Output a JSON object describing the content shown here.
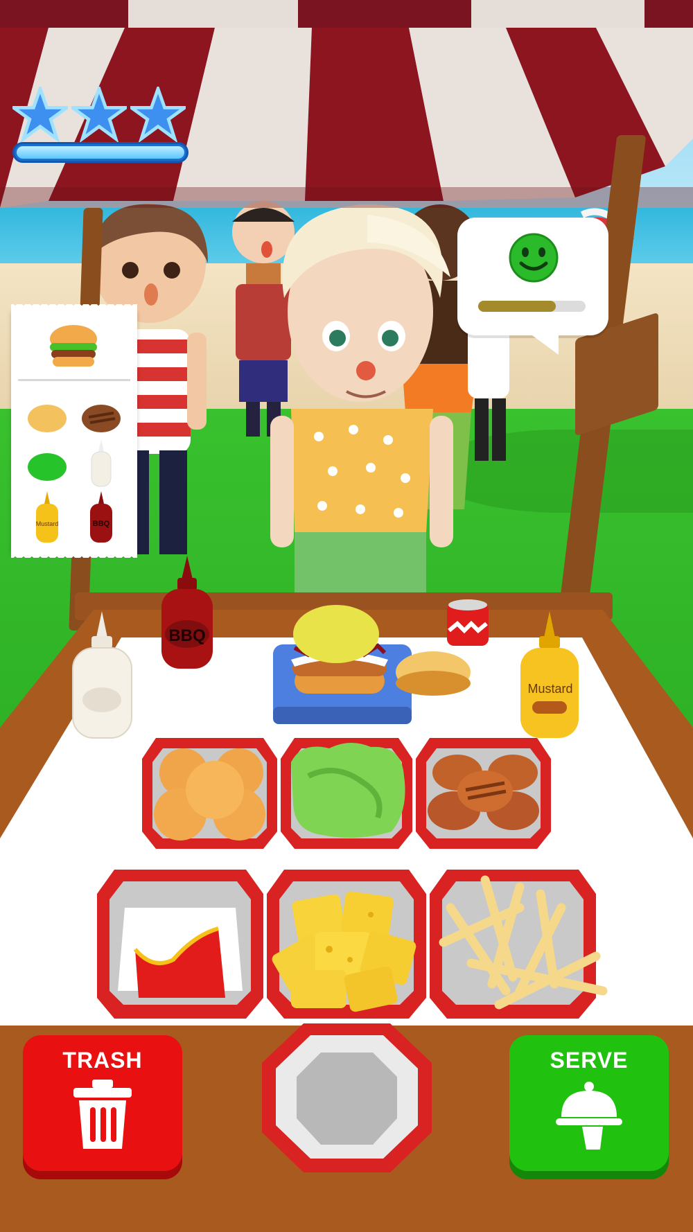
{
  "game": {
    "stars_earned": 3,
    "stars_total": 3,
    "level_progress": 1.0
  },
  "customer": {
    "mood": "happy",
    "patience": 0.72,
    "order_items": [
      "bun",
      "patty",
      "lettuce",
      "mayo",
      "mustard",
      "bbq-sauce"
    ]
  },
  "condiments": {
    "bbq_label": "BBQ",
    "mustard_label": "Mustard",
    "ticket_bbq_label": "BBQ",
    "ticket_mustard_label": "Mustard"
  },
  "buttons": {
    "trash_label": "TRASH",
    "serve_label": "SERVE"
  },
  "colors": {
    "trash": "#e81010",
    "serve": "#20c10f",
    "awning_red": "#8c1520",
    "awning_stripe": "#e9e2dc",
    "counter_wood": "#a95a1f",
    "tray_red": "#d92222"
  }
}
